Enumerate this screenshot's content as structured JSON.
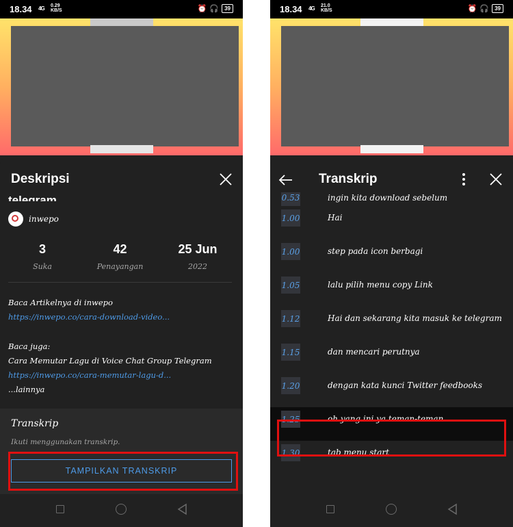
{
  "status_bar_left": {
    "time": "18.34",
    "signal": "4G",
    "speed_value": "0.29",
    "speed_unit": "KB/S",
    "battery": "39"
  },
  "status_bar_right": {
    "time": "18.34",
    "signal": "4G",
    "speed_value": "21.0",
    "speed_unit": "KB/S",
    "battery": "39"
  },
  "description_panel": {
    "title": "Deskripsi",
    "partial_video_title": "telegram",
    "channel": {
      "name": "inwepo"
    },
    "stats": [
      {
        "value": "3",
        "label": "Suka"
      },
      {
        "value": "42",
        "label": "Penayangan"
      },
      {
        "value": "25 Jun",
        "label": "2022"
      }
    ],
    "description": {
      "line1": "Baca Artikelnya di inwepo",
      "link1": "https://inwepo.co/cara-download-video...",
      "line2": "Baca juga:",
      "line3": "Cara Memutar Lagu di Voice Chat Group Telegram",
      "link2": "https://inwepo.co/cara-memutar-lagu-d...",
      "more": "...lainnya"
    },
    "transcript_section": {
      "heading": "Transkrip",
      "subtitle": "Ikuti menggunakan transkrip.",
      "button_label": "TAMPILKAN TRANSKRIP"
    }
  },
  "transcript_panel": {
    "title": "Transkrip",
    "rows": [
      {
        "time": "0.53",
        "text": "ingin kita download sebelum"
      },
      {
        "time": "1.00",
        "text": "Hai"
      },
      {
        "time": "1.00",
        "text": "step pada icon berbagi"
      },
      {
        "time": "1.05",
        "text": "lalu pilih menu copy Link"
      },
      {
        "time": "1.12",
        "text": "Hai dan sekarang kita masuk ke telegram"
      },
      {
        "time": "1.15",
        "text": "dan mencari perutnya"
      },
      {
        "time": "1.20",
        "text": "dengan kata kunci Twitter feedbooks"
      },
      {
        "time": "1.25",
        "text": "oh yang ini ya teman-teman"
      },
      {
        "time": "1.30",
        "text": "tab menu start"
      }
    ],
    "active_index": 7
  },
  "colors": {
    "highlight_box": "#e01010",
    "link": "#4e9be8",
    "panel_bg": "#212121"
  }
}
